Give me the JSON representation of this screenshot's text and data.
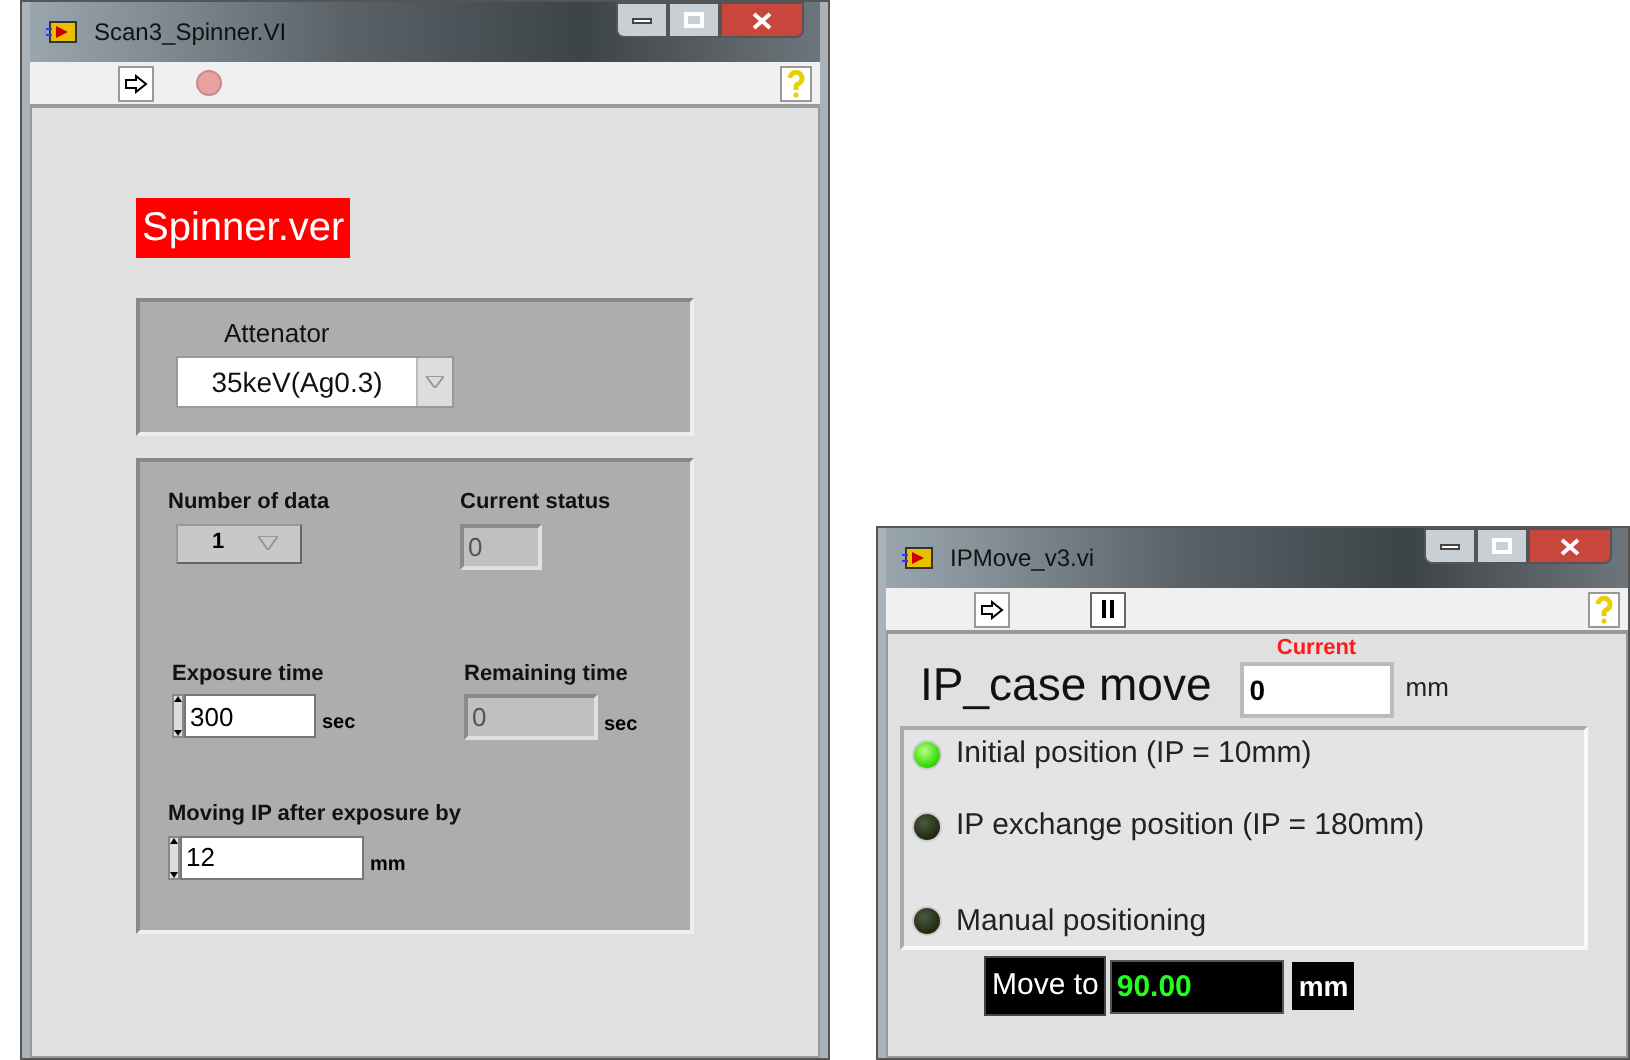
{
  "windows": [
    {
      "title": "Scan3_Spinner.VI",
      "toolbar": [
        {
          "kind": "run"
        },
        {
          "kind": "abort"
        },
        {
          "kind": "help"
        }
      ],
      "banner": "Spinner.ver",
      "attenuator": {
        "label": "Attenator",
        "value": "35keV(Ag0.3)"
      },
      "number_of_data": {
        "label": "Number of data",
        "value": "1"
      },
      "current_status": {
        "label": "Current status",
        "value": "0"
      },
      "exposure_time": {
        "label": "Exposure time",
        "value": "300",
        "unit": "sec"
      },
      "remaining_time": {
        "label": "Remaining time",
        "value": "0",
        "unit": "sec"
      },
      "moving_ip": {
        "label": "Moving IP after exposure by",
        "value": "12",
        "unit": "mm"
      }
    },
    {
      "title": "IPMove_v3.vi",
      "toolbar": [
        {
          "kind": "run"
        },
        {
          "kind": "pause"
        },
        {
          "kind": "help"
        }
      ],
      "heading": "IP_case move",
      "current": {
        "label": "Current",
        "value": "0",
        "unit": "mm"
      },
      "positions": [
        {
          "label": "Initial position (IP = 10mm)",
          "on": true
        },
        {
          "label": "IP exchange position (IP = 180mm)",
          "on": false
        },
        {
          "label": "Manual positioning",
          "on": false
        }
      ],
      "move_to": {
        "label": "Move to",
        "value": "90.00",
        "unit": "mm"
      }
    }
  ]
}
